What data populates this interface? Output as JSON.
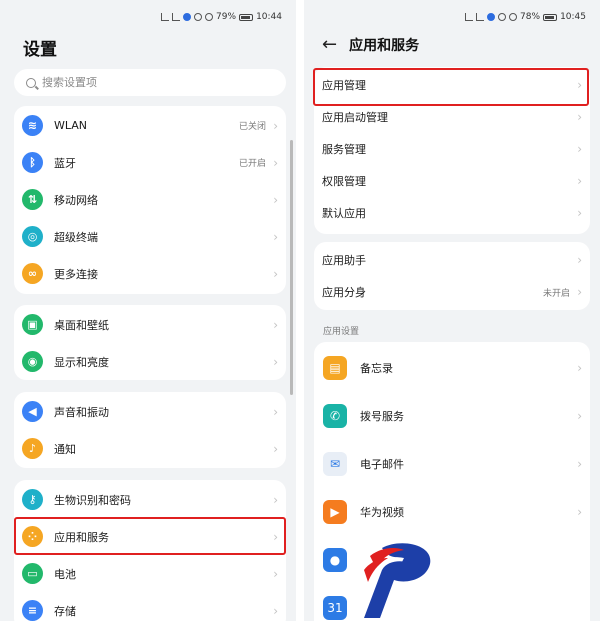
{
  "left": {
    "status_text": "79%",
    "status_time": "10:44",
    "title": "设置",
    "search_placeholder": "搜索设置项",
    "groups": [
      [
        {
          "label": "WLAN",
          "value": "已关闭",
          "icon": "wifi-icon",
          "color": "#3b82f6",
          "glyph": "≋"
        },
        {
          "label": "蓝牙",
          "value": "已开启",
          "icon": "bluetooth-icon",
          "color": "#3b82f6",
          "glyph": "ᛒ"
        },
        {
          "label": "移动网络",
          "value": "",
          "icon": "mobile-network-icon",
          "color": "#22b86b",
          "glyph": "⇅"
        },
        {
          "label": "超级终端",
          "value": "",
          "icon": "super-device-icon",
          "color": "#1fb0c9",
          "glyph": "◎"
        },
        {
          "label": "更多连接",
          "value": "",
          "icon": "more-connections-icon",
          "color": "#f5a623",
          "glyph": "∞"
        }
      ],
      [
        {
          "label": "桌面和壁纸",
          "value": "",
          "icon": "wallpaper-icon",
          "color": "#22b86b",
          "glyph": "▣"
        },
        {
          "label": "显示和亮度",
          "value": "",
          "icon": "display-icon",
          "color": "#22b86b",
          "glyph": "◉"
        }
      ],
      [
        {
          "label": "声音和振动",
          "value": "",
          "icon": "sound-icon",
          "color": "#3b82f6",
          "glyph": "◀"
        },
        {
          "label": "通知",
          "value": "",
          "icon": "bell-icon",
          "color": "#f5a623",
          "glyph": "♪"
        }
      ],
      [
        {
          "label": "生物识别和密码",
          "value": "",
          "icon": "key-icon",
          "color": "#1fb0c9",
          "glyph": "⚷"
        },
        {
          "label": "应用和服务",
          "value": "",
          "icon": "apps-icon",
          "color": "#f5a623",
          "glyph": "⁘"
        },
        {
          "label": "电池",
          "value": "",
          "icon": "battery-icon",
          "color": "#22b86b",
          "glyph": "▭"
        },
        {
          "label": "存储",
          "value": "",
          "icon": "storage-icon",
          "color": "#3b82f6",
          "glyph": "≡"
        }
      ]
    ]
  },
  "right": {
    "status_text": "78%",
    "status_time": "10:45",
    "title": "应用和服务",
    "group1": [
      {
        "label": "应用管理",
        "value": ""
      },
      {
        "label": "应用启动管理",
        "value": ""
      },
      {
        "label": "服务管理",
        "value": ""
      },
      {
        "label": "权限管理",
        "value": ""
      },
      {
        "label": "默认应用",
        "value": ""
      }
    ],
    "group2": [
      {
        "label": "应用助手",
        "value": ""
      },
      {
        "label": "应用分身",
        "value": "未开启"
      }
    ],
    "section_title": "应用设置",
    "apps": [
      {
        "label": "备忘录",
        "icon": "memo-icon",
        "color": "#f5a623",
        "glyph": "▤"
      },
      {
        "label": "拨号服务",
        "icon": "phone-icon",
        "color": "#19b3a6",
        "glyph": "✆"
      },
      {
        "label": "电子邮件",
        "icon": "email-icon",
        "color": "#e8eef6",
        "glyph": "✉"
      },
      {
        "label": "华为视频",
        "icon": "video-icon",
        "color": "#f57c1f",
        "glyph": "▶"
      },
      {
        "label": "",
        "icon": "contacts-icon",
        "color": "#2d7be5",
        "glyph": "●"
      },
      {
        "label": "",
        "icon": "calendar-icon",
        "color": "#2d7be5",
        "glyph": "31"
      }
    ]
  },
  "colors": {
    "highlight": "#e02020",
    "background": "#f1f3f5"
  }
}
